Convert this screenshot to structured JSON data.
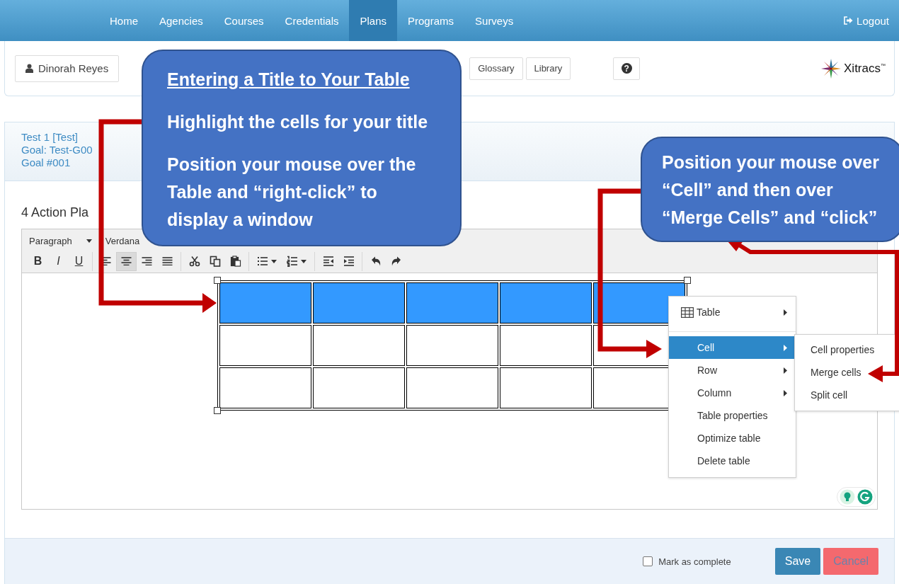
{
  "nav": {
    "items": [
      {
        "label": "Home",
        "selected": false
      },
      {
        "label": "Agencies",
        "selected": false
      },
      {
        "label": "Courses",
        "selected": false
      },
      {
        "label": "Credentials",
        "selected": false
      },
      {
        "label": "Plans",
        "selected": true
      },
      {
        "label": "Programs",
        "selected": false
      },
      {
        "label": "Surveys",
        "selected": false
      }
    ],
    "logout": "Logout"
  },
  "header": {
    "user": "Dinorah Reyes",
    "buttons": [
      "Glossary",
      "Library"
    ],
    "help": "?",
    "logo": "Xitracs$^{™}$"
  },
  "plan": {
    "lines": [
      "Test 1 [Test]",
      "Goal: Test-G00",
      "Goal #001"
    ],
    "section_title": "4 Action Pla"
  },
  "editor": {
    "format": "Paragraph",
    "font": "Verdana",
    "tool_groups": [
      [
        {
          "kind": "bold",
          "label": "B",
          "active": false
        },
        {
          "kind": "italic",
          "label": "I",
          "active": false
        },
        {
          "kind": "underline",
          "label": "U",
          "active": false
        }
      ],
      [
        {
          "kind": "align-left",
          "active": false
        },
        {
          "kind": "align-center",
          "active": true
        },
        {
          "kind": "align-right",
          "active": false
        },
        {
          "kind": "justify",
          "active": false
        }
      ],
      [
        {
          "kind": "cut",
          "active": false
        },
        {
          "kind": "copy",
          "active": false
        },
        {
          "kind": "paste",
          "active": false
        }
      ],
      [
        {
          "kind": "bullet-list",
          "active": false,
          "has_menu": true
        },
        {
          "kind": "number-list",
          "active": false,
          "has_menu": true
        }
      ],
      [
        {
          "kind": "outdent",
          "active": false
        },
        {
          "kind": "indent",
          "active": false
        }
      ],
      [
        {
          "kind": "undo",
          "active": false
        },
        {
          "kind": "redo",
          "active": false
        }
      ]
    ],
    "table": {
      "rows": [
        {
          "selected": true
        },
        {
          "selected": false
        },
        {
          "selected": false
        }
      ]
    },
    "context_menu": {
      "items": [
        {
          "kind": "grid",
          "label": "Table",
          "has_submenu": true,
          "selected": false
        },
        {
          "kind": "plain",
          "label": "Cell",
          "has_submenu": true,
          "selected": true,
          "submenu": [
            "Cell properties",
            "Merge cells",
            "Split cell"
          ]
        },
        {
          "kind": "plain",
          "label": "Row",
          "has_submenu": true,
          "selected": false
        },
        {
          "kind": "plain",
          "label": "Column",
          "has_submenu": true,
          "selected": false
        },
        {
          "kind": "plain",
          "label": "Table properties",
          "has_submenu": false,
          "selected": false
        },
        {
          "kind": "plain",
          "label": "Optimize table",
          "has_submenu": false,
          "selected": false
        },
        {
          "kind": "plain",
          "label": "Delete table",
          "has_submenu": false,
          "selected": false
        }
      ]
    }
  },
  "footer": {
    "complete": {
      "label": "Mark as complete",
      "checked": false
    },
    "buttons": [
      {
        "kind": "primary",
        "label": "Save",
        "disabled": false
      },
      {
        "kind": "danger",
        "label": "Cancel",
        "disabled": true
      }
    ]
  },
  "callouts": [
    {
      "title": "Entering a Title to Your Table",
      "paragraphs": [
        "Highlight the cells for your title",
        "Position your mouse over the Table and “right-click” to display a window"
      ]
    },
    {
      "paragraphs": [
        "Position your mouse over “Cell” and then over “Merge Cells” and “click”"
      ]
    }
  ]
}
